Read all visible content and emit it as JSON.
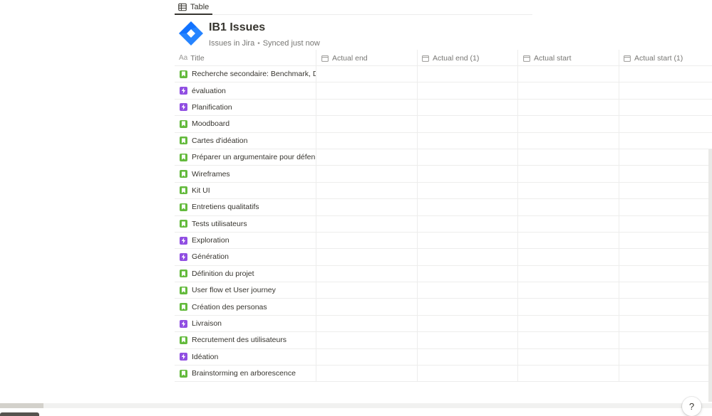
{
  "view": {
    "tab_label": "Table"
  },
  "database": {
    "title": "IB1 Issues",
    "subtitle_source": "Issues in Jira",
    "subtitle_sep": "•",
    "subtitle_sync": "Synced just now"
  },
  "columns": [
    {
      "label": "Title",
      "prefix": "Aa"
    },
    {
      "label": "Actual end"
    },
    {
      "label": "Actual end (1)"
    },
    {
      "label": "Actual start"
    },
    {
      "label": "Actual start (1)"
    }
  ],
  "rows": [
    {
      "title": "Recherche secondaire: Benchmark, D",
      "type": "story"
    },
    {
      "title": "évaluation",
      "type": "epic"
    },
    {
      "title": "Planification",
      "type": "epic"
    },
    {
      "title": "Moodboard",
      "type": "story"
    },
    {
      "title": "Cartes d'idéation",
      "type": "story"
    },
    {
      "title": "Préparer un argumentaire pour défen",
      "type": "story"
    },
    {
      "title": "Wireframes",
      "type": "story"
    },
    {
      "title": "Kit UI",
      "type": "story"
    },
    {
      "title": "Entretiens qualitatifs",
      "type": "story"
    },
    {
      "title": "Tests utilisateurs",
      "type": "story"
    },
    {
      "title": "Exploration",
      "type": "epic"
    },
    {
      "title": "Génération",
      "type": "epic"
    },
    {
      "title": "Définition du projet",
      "type": "story"
    },
    {
      "title": "User flow et User journey",
      "type": "story"
    },
    {
      "title": "Création des personas",
      "type": "story"
    },
    {
      "title": "Livraison",
      "type": "epic"
    },
    {
      "title": "Recrutement des utilisateurs",
      "type": "story"
    },
    {
      "title": "Idéation",
      "type": "epic"
    },
    {
      "title": "Brainstorming en arborescence",
      "type": "story"
    }
  ],
  "help": {
    "label": "?"
  },
  "colors": {
    "story": "#63ba3c",
    "epic": "#904ee2",
    "jira": "#2684ff"
  }
}
